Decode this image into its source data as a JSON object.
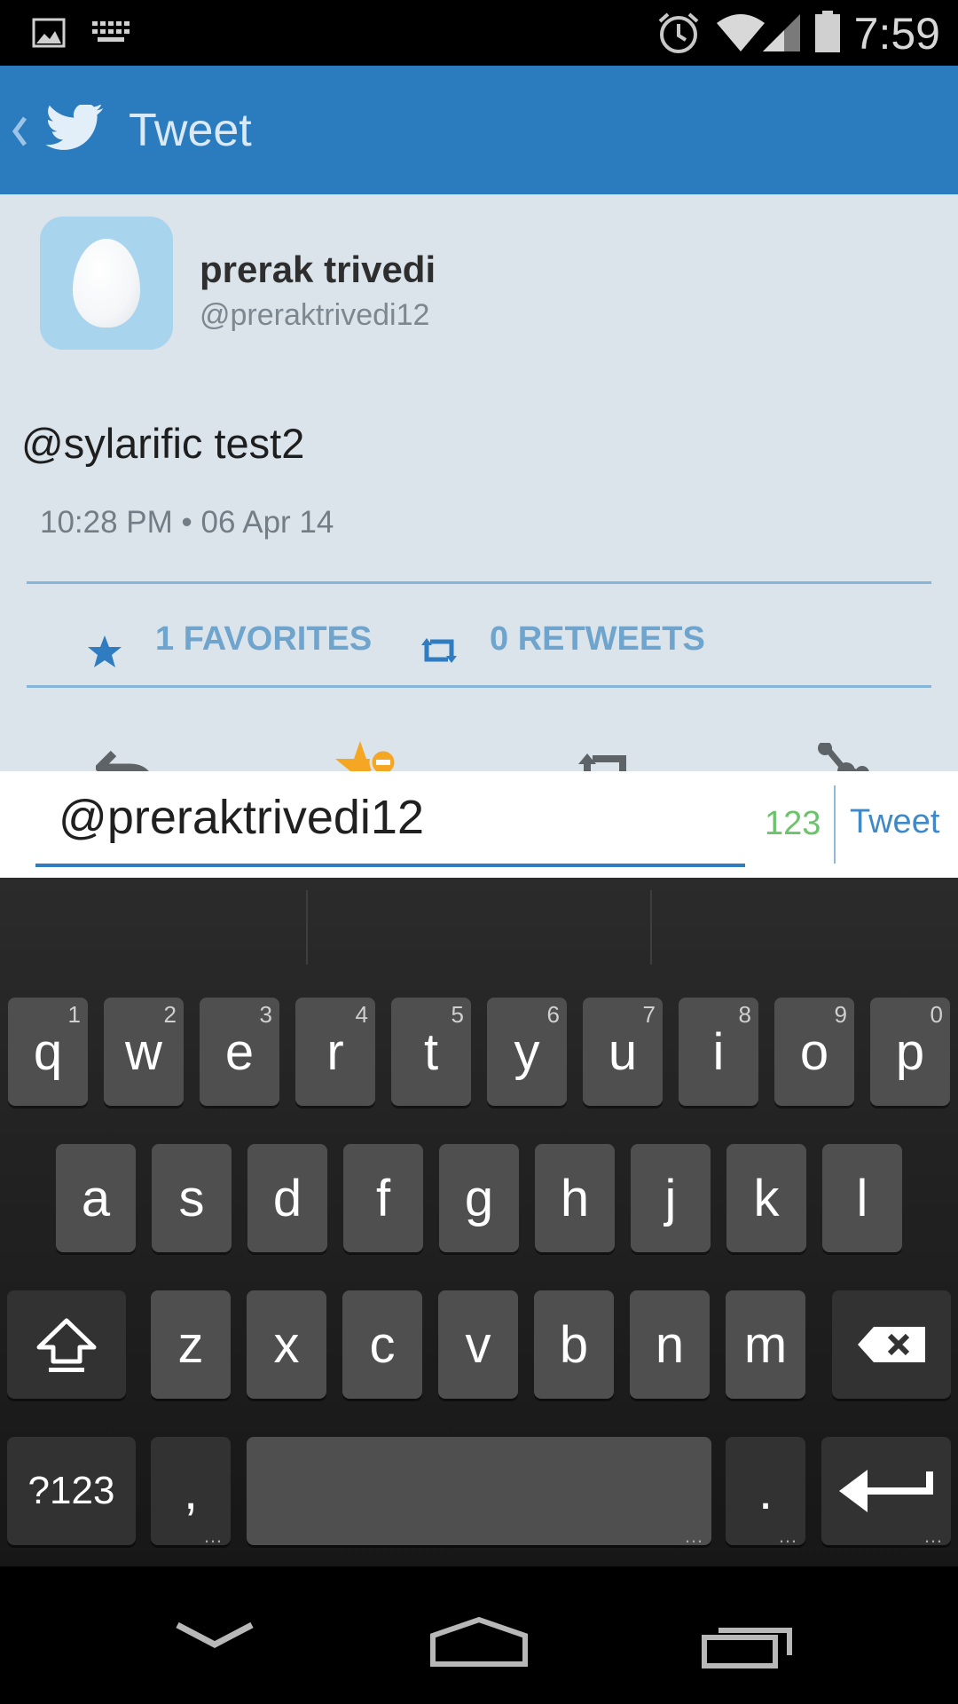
{
  "status_bar": {
    "time": "7:59"
  },
  "action_bar": {
    "title": "Tweet"
  },
  "tweet": {
    "author_name": "prerak trivedi",
    "author_handle": "@preraktrivedi12",
    "text": "@sylarific test2",
    "timestamp": "10:28 PM • 06 Apr 14",
    "favorites_label": "1 FAVORITES",
    "retweets_label": "0 RETWEETS"
  },
  "reply": {
    "value": "@preraktrivedi12 ",
    "char_count": "123",
    "tweet_button": "Tweet"
  },
  "keyboard": {
    "row1": [
      {
        "k": "q",
        "h": "1"
      },
      {
        "k": "w",
        "h": "2"
      },
      {
        "k": "e",
        "h": "3"
      },
      {
        "k": "r",
        "h": "4"
      },
      {
        "k": "t",
        "h": "5"
      },
      {
        "k": "y",
        "h": "6"
      },
      {
        "k": "u",
        "h": "7"
      },
      {
        "k": "i",
        "h": "8"
      },
      {
        "k": "o",
        "h": "9"
      },
      {
        "k": "p",
        "h": "0"
      }
    ],
    "row2": [
      "a",
      "s",
      "d",
      "f",
      "g",
      "h",
      "j",
      "k",
      "l"
    ],
    "row3": [
      "z",
      "x",
      "c",
      "v",
      "b",
      "n",
      "m"
    ],
    "symbols_key": "?123",
    "comma_key": ",",
    "period_key": "."
  },
  "colors": {
    "action_bar": "#2b7bbf",
    "tweet_bg": "#dbe4ea",
    "favorite_star": "#2f7cc1",
    "char_count": "#6cc36c",
    "accent": "#2f7cc1"
  },
  "icons": {
    "status_left": [
      "image-icon",
      "keyboard-icon"
    ],
    "status_right": [
      "alarm-icon",
      "wifi-icon",
      "signal-icon",
      "battery-icon"
    ],
    "action_bar": [
      "back-chevron-icon",
      "twitter-bird-icon"
    ],
    "tweet_actions": [
      "reply-icon",
      "unfavorite-icon",
      "retweet-icon",
      "share-icon"
    ],
    "keyboard": [
      "shift-icon",
      "backspace-icon",
      "enter-icon"
    ],
    "nav_bar": [
      "back-icon",
      "home-icon",
      "recents-icon"
    ]
  }
}
